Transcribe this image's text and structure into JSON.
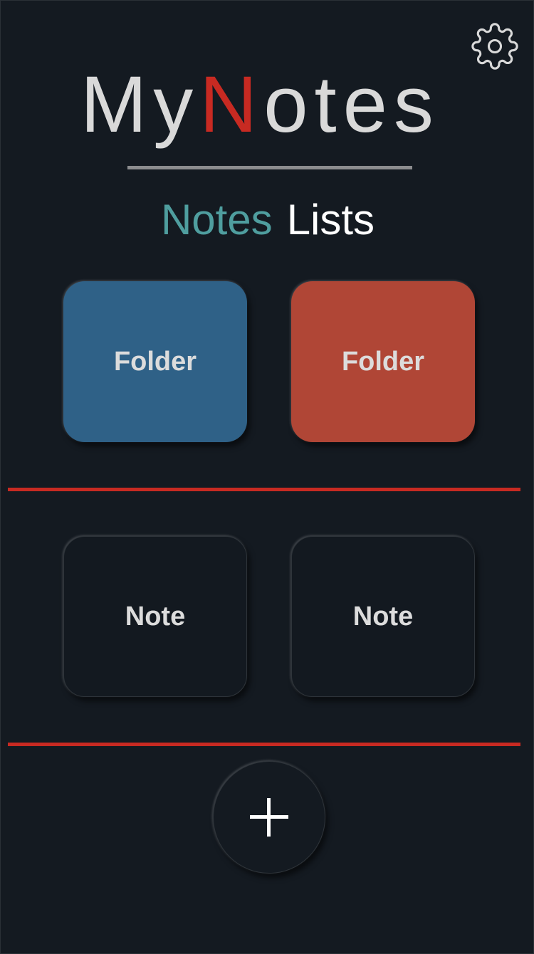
{
  "header": {
    "title_parts": [
      "My",
      "N",
      "otes"
    ],
    "settings_icon": "gear-icon",
    "accent_color": "#c82a22"
  },
  "tabs": [
    {
      "label": "Notes",
      "color": "#4f9e9f"
    },
    {
      "label": "Lists",
      "color": "#ffffff"
    }
  ],
  "folders": [
    {
      "label": "Folder",
      "color": "#2f6187"
    },
    {
      "label": "Folder",
      "color": "#b04636"
    }
  ],
  "notes": [
    {
      "label": "Note"
    },
    {
      "label": "Note"
    }
  ],
  "add_button": {
    "icon": "plus-icon"
  }
}
